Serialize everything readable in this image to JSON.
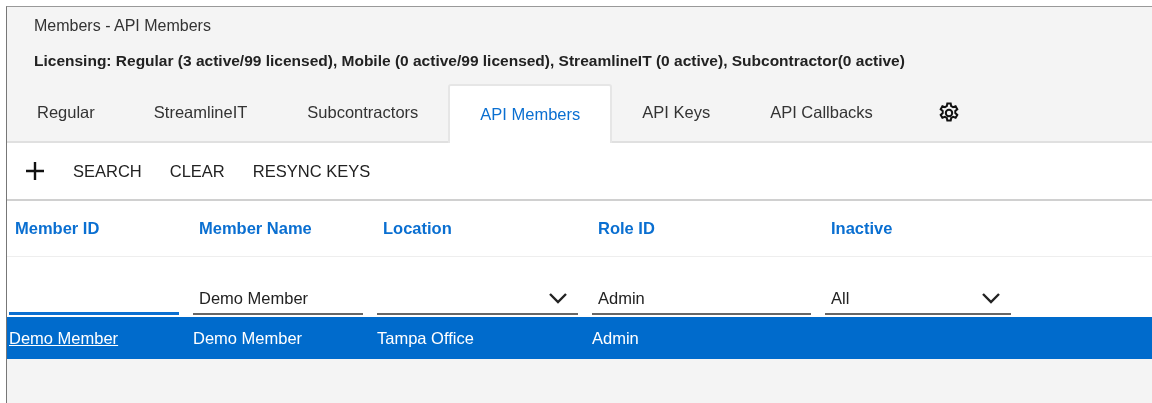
{
  "page": {
    "title": "Members - API Members",
    "licensing": "Licensing: Regular (3 active/99 licensed), Mobile (0 active/99 licensed), StreamlineIT (0 active), Subcontractor(0 active)"
  },
  "tabs": [
    {
      "label": "Regular",
      "selected": false
    },
    {
      "label": "StreamlineIT",
      "selected": false
    },
    {
      "label": "Subcontractors",
      "selected": false
    },
    {
      "label": "API Members",
      "selected": true
    },
    {
      "label": "API Keys",
      "selected": false
    },
    {
      "label": "API Callbacks",
      "selected": false
    }
  ],
  "toolbar": [
    "SEARCH",
    "CLEAR",
    "RESYNC KEYS"
  ],
  "table": {
    "columns": [
      "Member ID",
      "Member Name",
      "Location",
      "Role ID",
      "Inactive"
    ],
    "filters": [
      {
        "kind": "text",
        "focused": true
      },
      {
        "kind": "text",
        "value": "Demo Member",
        "focused": false
      },
      {
        "kind": "select",
        "focused": false
      },
      {
        "kind": "text",
        "value": "Admin",
        "focused": false
      },
      {
        "kind": "select",
        "value": "All",
        "focused": false
      }
    ],
    "rows": [
      {
        "selected": true,
        "cells": [
          "Demo Member",
          "Demo Member",
          "Tampa Office",
          "Admin"
        ]
      }
    ]
  }
}
